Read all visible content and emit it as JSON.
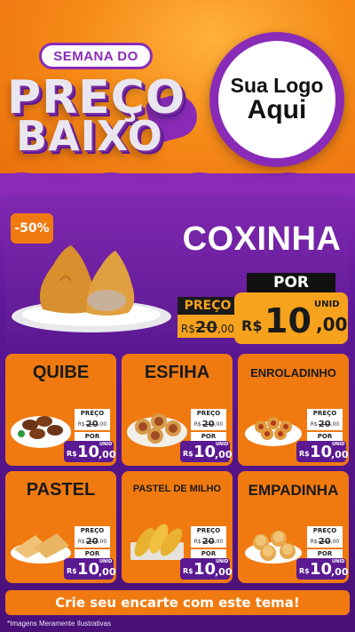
{
  "header": {
    "badge": "SEMANA DO",
    "title_line1": "PREÇO",
    "title_line2": "BAIXO",
    "logo_line1": "Sua Logo",
    "logo_line2": "Aqui"
  },
  "hero": {
    "discount": "-50%",
    "name": "COXINHA",
    "preco_label": "PREÇO",
    "old_currency": "R$",
    "old_int": "20",
    "old_dec": ",00",
    "por_label": "POR",
    "currency": "R$",
    "price_int": "10",
    "price_dec": ",00",
    "unit": "UNID"
  },
  "products": [
    {
      "name": "QUIBE",
      "preco_label": "PREÇO",
      "old_currency": "R$",
      "old_int": "20",
      "old_dec": ",00",
      "por_label": "POR",
      "currency": "R$",
      "price_int": "10",
      "price_dec": ",00",
      "unit": "UNID"
    },
    {
      "name": "ESFIHA",
      "preco_label": "PREÇO",
      "old_currency": "R$",
      "old_int": "20",
      "old_dec": ",00",
      "por_label": "POR",
      "currency": "R$",
      "price_int": "10",
      "price_dec": ",00",
      "unit": "UNID"
    },
    {
      "name": "ENROLADINHO",
      "preco_label": "PREÇO",
      "old_currency": "R$",
      "old_int": "20",
      "old_dec": ",00",
      "por_label": "POR",
      "currency": "R$",
      "price_int": "10",
      "price_dec": ",00",
      "unit": "UNID"
    },
    {
      "name": "PASTEL",
      "preco_label": "PREÇO",
      "old_currency": "R$",
      "old_int": "20",
      "old_dec": ",00",
      "por_label": "POR",
      "currency": "R$",
      "price_int": "10",
      "price_dec": ",00",
      "unit": "UNID"
    },
    {
      "name": "PASTEL DE MILHO",
      "preco_label": "PREÇO",
      "old_currency": "R$",
      "old_int": "20",
      "old_dec": ",00",
      "por_label": "POR",
      "currency": "R$",
      "price_int": "10",
      "price_dec": ",00",
      "unit": "UNID"
    },
    {
      "name": "EMPADINHA",
      "preco_label": "PREÇO",
      "old_currency": "R$",
      "old_int": "20",
      "old_dec": ",00",
      "por_label": "POR",
      "currency": "R$",
      "price_int": "10",
      "price_dec": ",00",
      "unit": "UNID"
    }
  ],
  "cta": "Crie seu encarte com este tema!",
  "disclaimer": "*Imagens Meramente Ilustrativas",
  "colors": {
    "orange": "#f07a10",
    "purple": "#5b1992",
    "accent": "#f6a21c"
  }
}
